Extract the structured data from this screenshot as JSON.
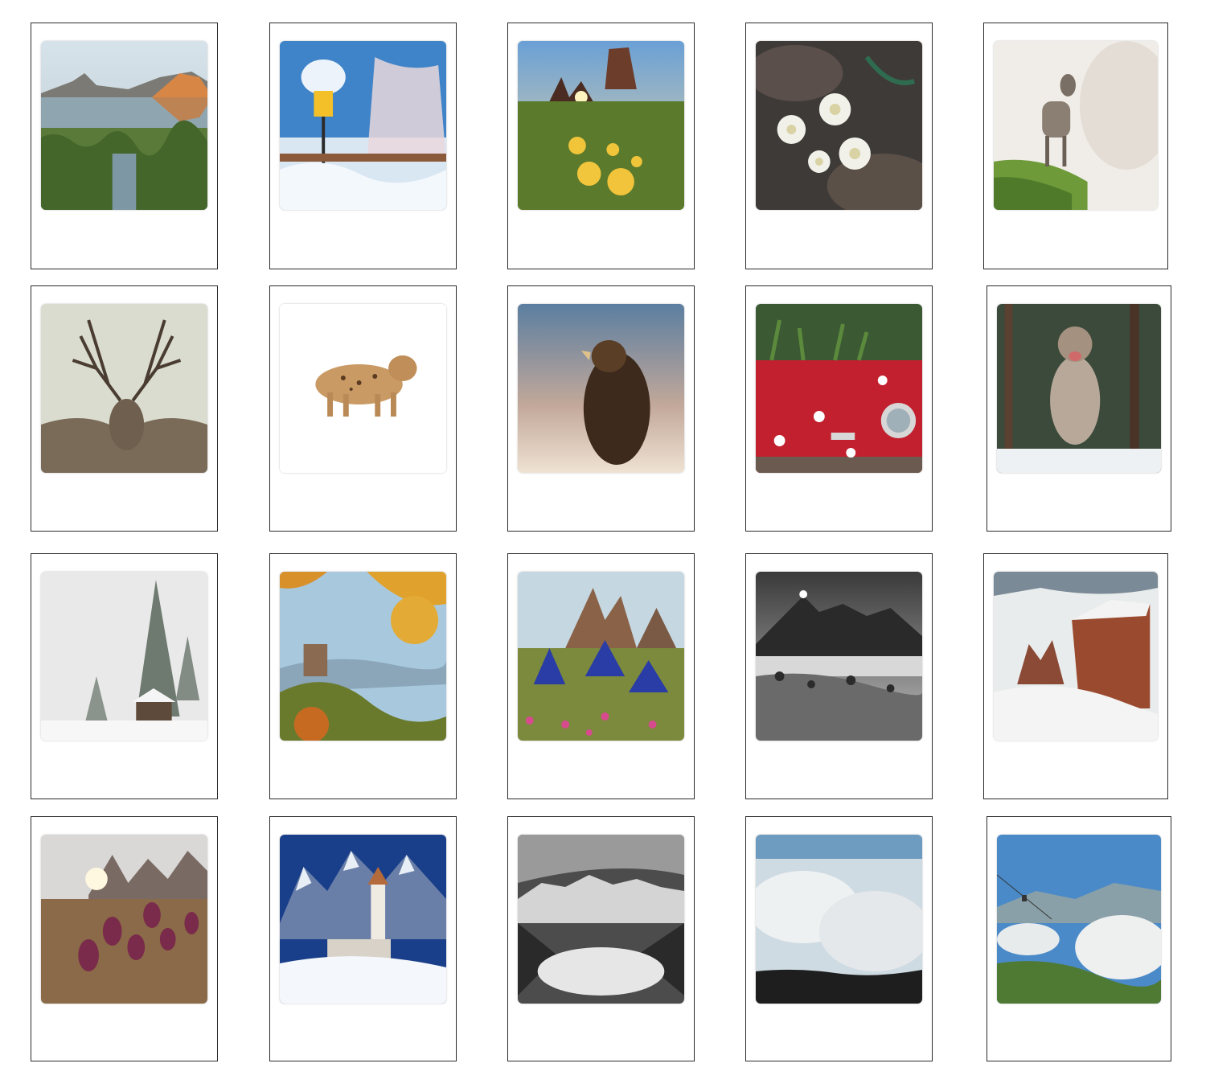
{
  "sheet": {
    "background": "#ffffff",
    "frame_border": "#2a2a2a",
    "photos": [
      {
        "subject": "mountain-lake-reflection"
      },
      {
        "subject": "snowy-street-lamp"
      },
      {
        "subject": "sunrise-rock-towers-yellow-flowers"
      },
      {
        "subject": "edelweiss"
      },
      {
        "subject": "young-ibex-on-grass"
      },
      {
        "subject": "red-deer-stag"
      },
      {
        "subject": "walking-lynx"
      },
      {
        "subject": "golden-eagle"
      },
      {
        "subject": "red-fiat-with-plants"
      },
      {
        "subject": "wolf-in-snowy-forest"
      },
      {
        "subject": "snowy-firs-and-hut"
      },
      {
        "subject": "castle-autumn-valley"
      },
      {
        "subject": "blue-gentians-three-peaks"
      },
      {
        "subject": "misty-alpine-meadow-bw"
      },
      {
        "subject": "red-cliffs-above-clouds"
      },
      {
        "subject": "pasque-flowers-mountains"
      },
      {
        "subject": "church-winter-dolomites"
      },
      {
        "subject": "mountain-range-fog-bw"
      },
      {
        "subject": "clouds-over-ridge"
      },
      {
        "subject": "cable-car-green-valley"
      }
    ]
  }
}
